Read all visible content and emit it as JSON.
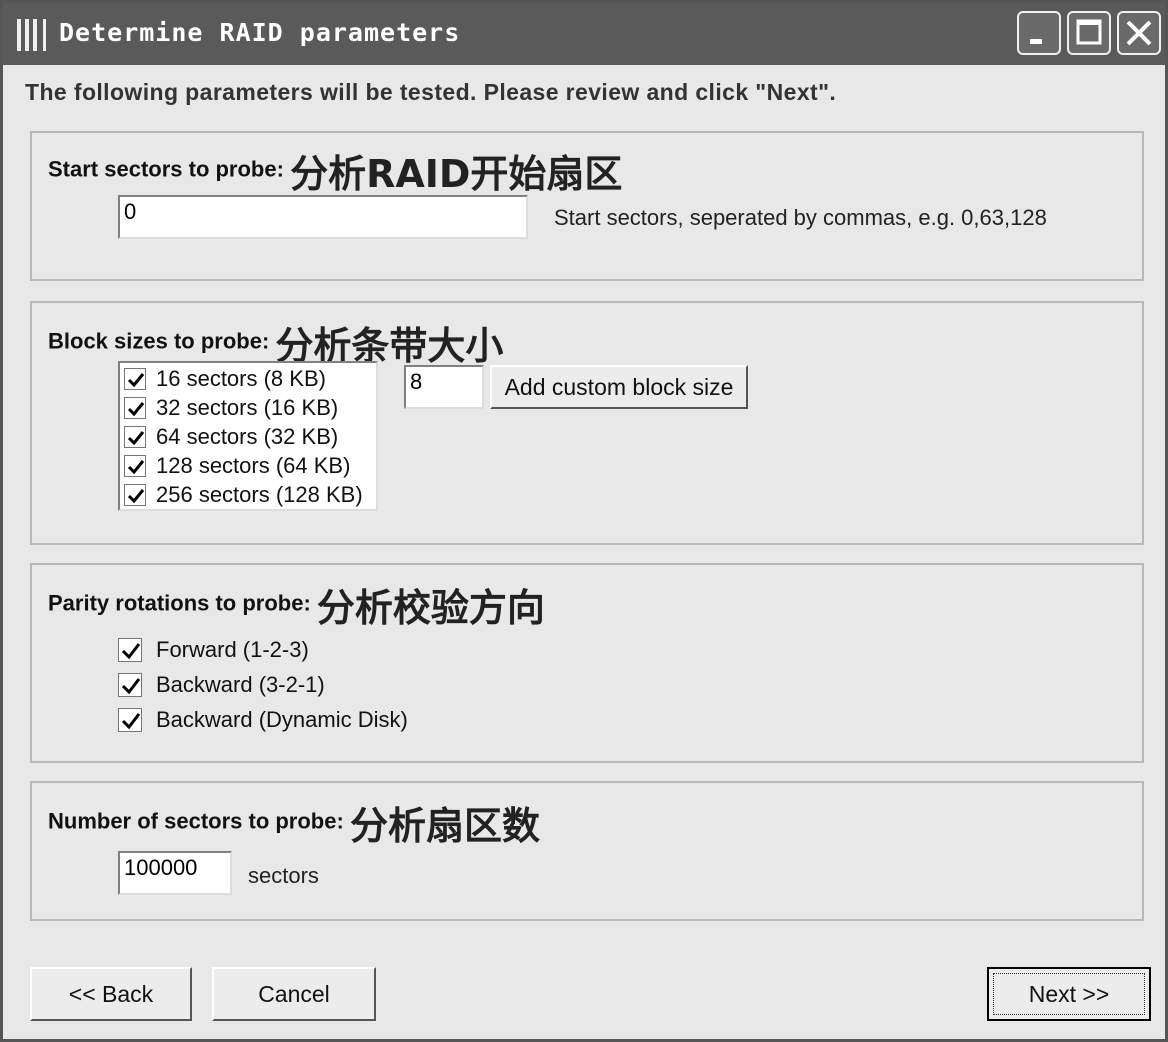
{
  "window": {
    "title": "Determine RAID parameters",
    "controls": [
      "minimize",
      "maximize",
      "close"
    ]
  },
  "intro_text": "The following parameters will be tested. Please review and click \"Next\".",
  "start_sectors": {
    "label": "Start sectors to probe:",
    "label_cn": "分析RAID开始扇区",
    "value": "0",
    "hint": "Start sectors, seperated by commas, e.g. 0,63,128"
  },
  "block_sizes": {
    "label": "Block sizes to probe:",
    "label_cn": "分析条带大小",
    "items": [
      {
        "label": "16 sectors (8 KB)",
        "checked": true
      },
      {
        "label": "32 sectors (16 KB)",
        "checked": true
      },
      {
        "label": "64 sectors (32 KB)",
        "checked": true
      },
      {
        "label": "128 sectors (64 KB)",
        "checked": true
      },
      {
        "label": "256 sectors (128 KB)",
        "checked": true
      }
    ],
    "custom_value": "8",
    "add_button": "Add custom block size"
  },
  "parity": {
    "label": "Parity rotations to probe:",
    "label_cn": "分析校验方向",
    "items": [
      {
        "label": "Forward (1-2-3)",
        "checked": true
      },
      {
        "label": "Backward (3-2-1)",
        "checked": true
      },
      {
        "label": "Backward (Dynamic Disk)",
        "checked": true
      }
    ]
  },
  "num_sectors": {
    "label": "Number of sectors to probe:",
    "label_cn": "分析扇区数",
    "value": "100000",
    "unit": "sectors"
  },
  "buttons": {
    "back": "<< Back",
    "cancel": "Cancel",
    "next": "Next >>"
  }
}
